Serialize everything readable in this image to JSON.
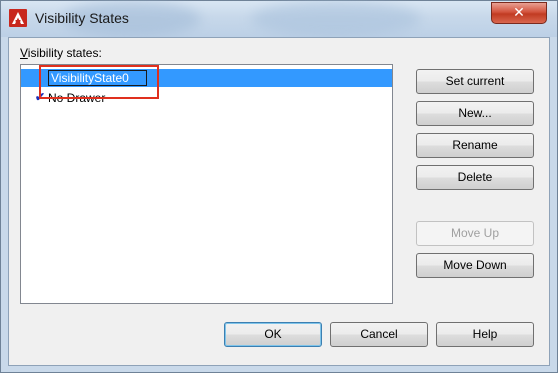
{
  "window": {
    "title": "Visibility States",
    "close_glyph": "✕",
    "app_icon": "autocad-a-icon"
  },
  "list": {
    "label": "Visibility states:",
    "items": [
      {
        "name": "VisibilityState0",
        "selected": true,
        "editing": true,
        "current": false
      },
      {
        "name": "No Drawer",
        "selected": false,
        "editing": false,
        "current": true
      }
    ],
    "current_mark": "✔"
  },
  "side_buttons": {
    "set_current": "Set current",
    "new": "New...",
    "rename": "Rename",
    "delete": "Delete",
    "move_up": "Move Up",
    "move_down": "Move Down"
  },
  "footer_buttons": {
    "ok": "OK",
    "cancel": "Cancel",
    "help": "Help"
  },
  "colors": {
    "selection": "#3399ff",
    "highlight_box": "#e0301e",
    "check": "#1f2fb8"
  }
}
